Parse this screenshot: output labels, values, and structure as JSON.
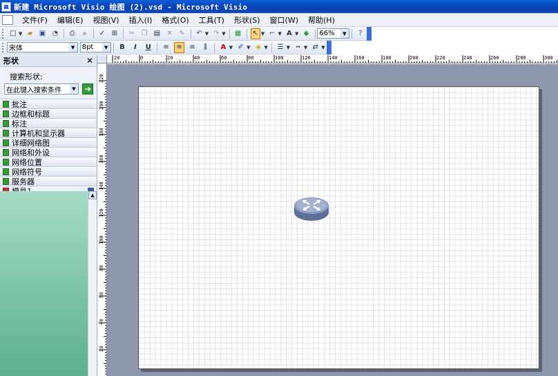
{
  "window": {
    "title": "新建 Microsoft Visio 绘图 (2).vsd - Microsoft Visio"
  },
  "menu": [
    "文件(F)",
    "编辑(E)",
    "视图(V)",
    "插入(I)",
    "格式(O)",
    "工具(T)",
    "形状(S)",
    "窗口(W)",
    "帮助(H)"
  ],
  "toolbar": {
    "zoom": "66%"
  },
  "format_toolbar": {
    "font": "宋体",
    "size": "8pt",
    "bold": "B",
    "italic": "I",
    "underline": "U"
  },
  "shapes_pane": {
    "title": "形状",
    "search_label": "搜索形状:",
    "search_placeholder": "在此键入搜索条件",
    "stencils": [
      "批注",
      "边框和标题",
      "标注",
      "计算机和显示器",
      "详细网络图",
      "网络和外设",
      "网络位置",
      "网络符号",
      "服务器"
    ],
    "active_stencil": "模具1"
  },
  "ruler_h_labels": [
    "20",
    "0",
    "20",
    "40",
    "60",
    "80",
    "100",
    "120",
    "140",
    "160",
    "180",
    "200",
    "220",
    "240",
    "260",
    "280",
    "300"
  ],
  "ruler_v_labels": [
    "220",
    "200",
    "180",
    "160",
    "140",
    "120",
    "100",
    "80",
    "60",
    "40",
    "20"
  ],
  "icons": {
    "router": "router-icon"
  }
}
